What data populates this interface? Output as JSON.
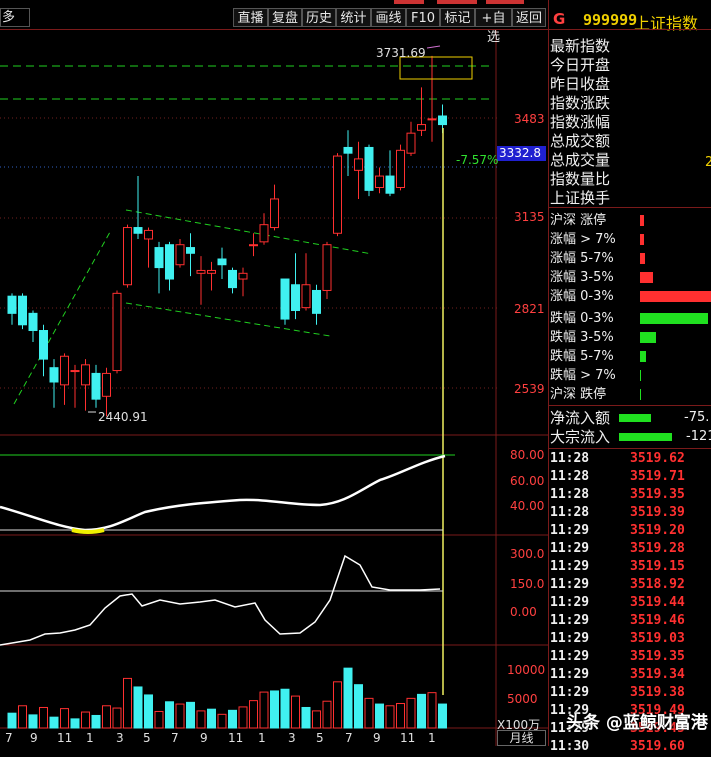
{
  "toolbar": {
    "left_label": "多",
    "buttons": [
      "直播",
      "复盘",
      "历史",
      "统计",
      "画线",
      "F10",
      "标记",
      "+自选",
      "返回"
    ]
  },
  "header": {
    "flag": "G",
    "code": "999999",
    "name": "上证指数"
  },
  "info_labels": [
    "最新指数",
    "今日开盘",
    "昨日收盘",
    "指数涨跌",
    "指数涨幅",
    "总成交额",
    "总成交量",
    "指数量比",
    "上证换手"
  ],
  "info_partial_value": "2",
  "breadth": {
    "rows": [
      {
        "label": "沪深 涨停",
        "color": "#ff3030",
        "frac": 0.03
      },
      {
        "label": "涨幅 > 7%",
        "color": "#ff3030",
        "frac": 0.03
      },
      {
        "label": "涨幅 5-7%",
        "color": "#ff3030",
        "frac": 0.035
      },
      {
        "label": "涨幅 3-5%",
        "color": "#ff3030",
        "frac": 0.09
      },
      {
        "label": "涨幅 0-3%",
        "color": "#ff3030",
        "frac": 0.5
      },
      {
        "label": "跌幅 0-3%",
        "color": "#20e020",
        "frac": 0.48
      },
      {
        "label": "跌幅 3-5%",
        "color": "#20e020",
        "frac": 0.11
      },
      {
        "label": "跌幅 5-7%",
        "color": "#20e020",
        "frac": 0.045
      },
      {
        "label": "跌幅 > 7%",
        "color": "#20e020",
        "frac": 0.008
      },
      {
        "label": "沪深 跌停",
        "color": "#20e020",
        "frac": 0.008
      }
    ]
  },
  "flows": [
    {
      "label": "净流入额",
      "value": "-75."
    },
    {
      "label": "大宗流入",
      "value": "-121"
    }
  ],
  "ticks": [
    {
      "time": "11:28",
      "price": "3519.62"
    },
    {
      "time": "11:28",
      "price": "3519.71"
    },
    {
      "time": "11:28",
      "price": "3519.35"
    },
    {
      "time": "11:28",
      "price": "3519.39"
    },
    {
      "time": "11:29",
      "price": "3519.20"
    },
    {
      "time": "11:29",
      "price": "3519.28"
    },
    {
      "time": "11:29",
      "price": "3519.15"
    },
    {
      "time": "11:29",
      "price": "3518.92"
    },
    {
      "time": "11:29",
      "price": "3519.44"
    },
    {
      "time": "11:29",
      "price": "3519.46"
    },
    {
      "time": "11:29",
      "price": "3519.03"
    },
    {
      "time": "11:29",
      "price": "3519.35"
    },
    {
      "time": "11:29",
      "price": "3519.34"
    },
    {
      "time": "11:29",
      "price": "3519.38"
    },
    {
      "time": "11:29",
      "price": "3519.49"
    },
    {
      "time": "11:29",
      "price": "3519.45"
    },
    {
      "time": "11:30",
      "price": "3519.60"
    }
  ],
  "main_chart": {
    "y_labels": [
      "3483",
      "3135",
      "2821",
      "2539"
    ],
    "current_price": "3332.8",
    "change_pct": "-7.57%",
    "high_annotation": "3731.69",
    "low_annotation": "2440.91",
    "candles": [
      [
        2860,
        2800,
        2870,
        2760
      ],
      [
        2860,
        2760,
        2870,
        2745
      ],
      [
        2800,
        2740,
        2810,
        2700
      ],
      [
        2740,
        2640,
        2760,
        2580
      ],
      [
        2610,
        2560,
        2640,
        2470
      ],
      [
        2550,
        2650,
        2660,
        2480
      ],
      [
        2600,
        2600,
        2620,
        2470
      ],
      [
        2550,
        2620,
        2640,
        2460
      ],
      [
        2590,
        2500,
        2620,
        2470
      ],
      [
        2510,
        2590,
        2610,
        2440
      ],
      [
        2600,
        2870,
        2880,
        2590
      ],
      [
        2900,
        3100,
        3110,
        2890
      ],
      [
        3100,
        3080,
        3280,
        3060
      ],
      [
        3060,
        3090,
        3100,
        2960
      ],
      [
        3030,
        2960,
        3050,
        2870
      ],
      [
        3040,
        2920,
        3050,
        2880
      ],
      [
        2970,
        3040,
        3060,
        2960
      ],
      [
        3030,
        3010,
        3080,
        2930
      ],
      [
        2940,
        2950,
        3000,
        2830
      ],
      [
        2940,
        2950,
        2980,
        2880
      ],
      [
        2990,
        2970,
        3030,
        2920
      ],
      [
        2950,
        2890,
        2960,
        2870
      ],
      [
        2920,
        2940,
        2960,
        2860
      ],
      [
        3040,
        3040,
        3080,
        3000
      ],
      [
        3050,
        3110,
        3150,
        3040
      ],
      [
        3100,
        3200,
        3250,
        3090
      ],
      [
        2920,
        2780,
        2920,
        2760
      ],
      [
        2900,
        2810,
        3010,
        2780
      ],
      [
        2820,
        2900,
        3010,
        2810
      ],
      [
        2880,
        2800,
        2900,
        2760
      ],
      [
        2880,
        3040,
        3050,
        2850
      ],
      [
        3080,
        3350,
        3360,
        3070
      ],
      [
        3380,
        3360,
        3440,
        3280
      ],
      [
        3300,
        3340,
        3400,
        3200
      ],
      [
        3380,
        3230,
        3390,
        3210
      ],
      [
        3240,
        3280,
        3310,
        3220
      ],
      [
        3280,
        3220,
        3370,
        3210
      ],
      [
        3240,
        3370,
        3390,
        3230
      ],
      [
        3360,
        3430,
        3470,
        3350
      ],
      [
        3440,
        3460,
        3590,
        3420
      ],
      [
        3480,
        3480,
        3700,
        3400
      ],
      [
        3490,
        3460,
        3530,
        3430
      ]
    ]
  },
  "osc1": {
    "y_labels": [
      "80.00",
      "60.00",
      "40.00"
    ]
  },
  "osc2": {
    "y_labels": [
      "300.0",
      "150.0",
      "0.00"
    ]
  },
  "volume": {
    "y_labels": [
      "10000",
      "5000"
    ],
    "unit": "X100万",
    "values": [
      2600,
      3900,
      2300,
      3600,
      1900,
      3400,
      1600,
      2800,
      2200,
      3900,
      3500,
      8700,
      7200,
      5800,
      2900,
      4600,
      4200,
      4500,
      3000,
      3300,
      2400,
      3100,
      3700,
      4800,
      6300,
      6500,
      6800,
      5600,
      3600,
      3000,
      4700,
      8100,
      10500,
      7600,
      5200,
      4200,
      3900,
      4300,
      5200,
      5900,
      6200,
      4200
    ],
    "up": [
      false,
      true,
      false,
      true,
      false,
      true,
      false,
      true,
      false,
      true,
      true,
      true,
      false,
      false,
      true,
      false,
      true,
      false,
      true,
      false,
      true,
      false,
      true,
      true,
      true,
      false,
      false,
      true,
      false,
      true,
      true,
      true,
      false,
      false,
      true,
      false,
      true,
      true,
      true,
      false,
      true,
      false
    ]
  },
  "x_labels": [
    "7",
    "9",
    "11",
    "1",
    "3",
    "5",
    "7",
    "9",
    "11",
    "1",
    "3",
    "5",
    "7",
    "9",
    "11",
    "1"
  ],
  "period_button": "月线",
  "watermark": "头条 @蓝鲸财富港"
}
